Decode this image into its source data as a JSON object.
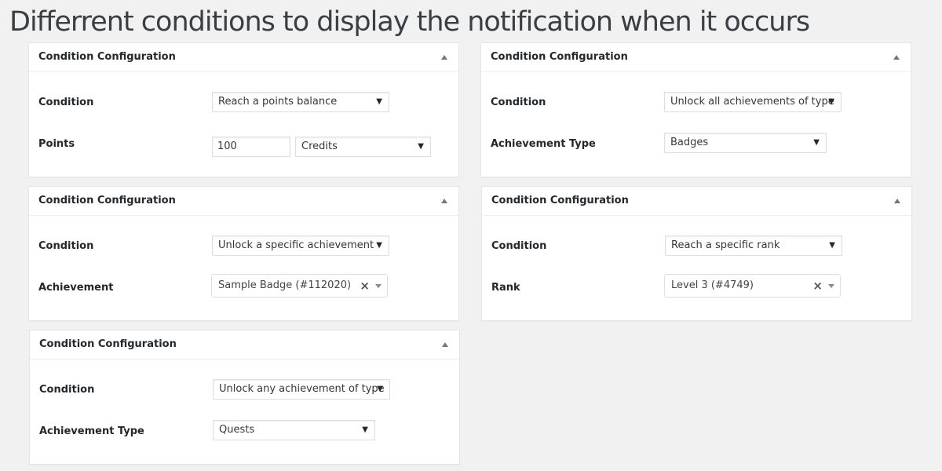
{
  "page": {
    "title": "Differrent conditions to display the notification when it occurs"
  },
  "boxes": {
    "points_balance": {
      "title": "Condition Configuration",
      "condition_label": "Condition",
      "condition_value": "Reach a points balance",
      "points_label": "Points",
      "points_value": "100",
      "points_type_value": "Credits"
    },
    "all_achievements_type": {
      "title": "Condition Configuration",
      "condition_label": "Condition",
      "condition_value": "Unlock all achievements of type",
      "type_label": "Achievement Type",
      "type_value": "Badges"
    },
    "specific_achievement": {
      "title": "Condition Configuration",
      "condition_label": "Condition",
      "condition_value": "Unlock a specific achievement",
      "achievement_label": "Achievement",
      "achievement_value": "Sample Badge (#112020)"
    },
    "specific_rank": {
      "title": "Condition Configuration",
      "condition_label": "Condition",
      "condition_value": "Reach a specific rank",
      "rank_label": "Rank",
      "rank_value": "Level 3 (#4749)"
    },
    "any_achievement_type": {
      "title": "Condition Configuration",
      "condition_label": "Condition",
      "condition_value": "Unlock any achievement of type",
      "type_label": "Achievement Type",
      "type_value": "Quests"
    }
  },
  "glyphs": {
    "caret": "▼",
    "clear": "×"
  },
  "icons": {
    "collapse": "collapse-arrow-up-icon",
    "dropdown": "chevron-down-icon",
    "clear": "close-icon"
  }
}
